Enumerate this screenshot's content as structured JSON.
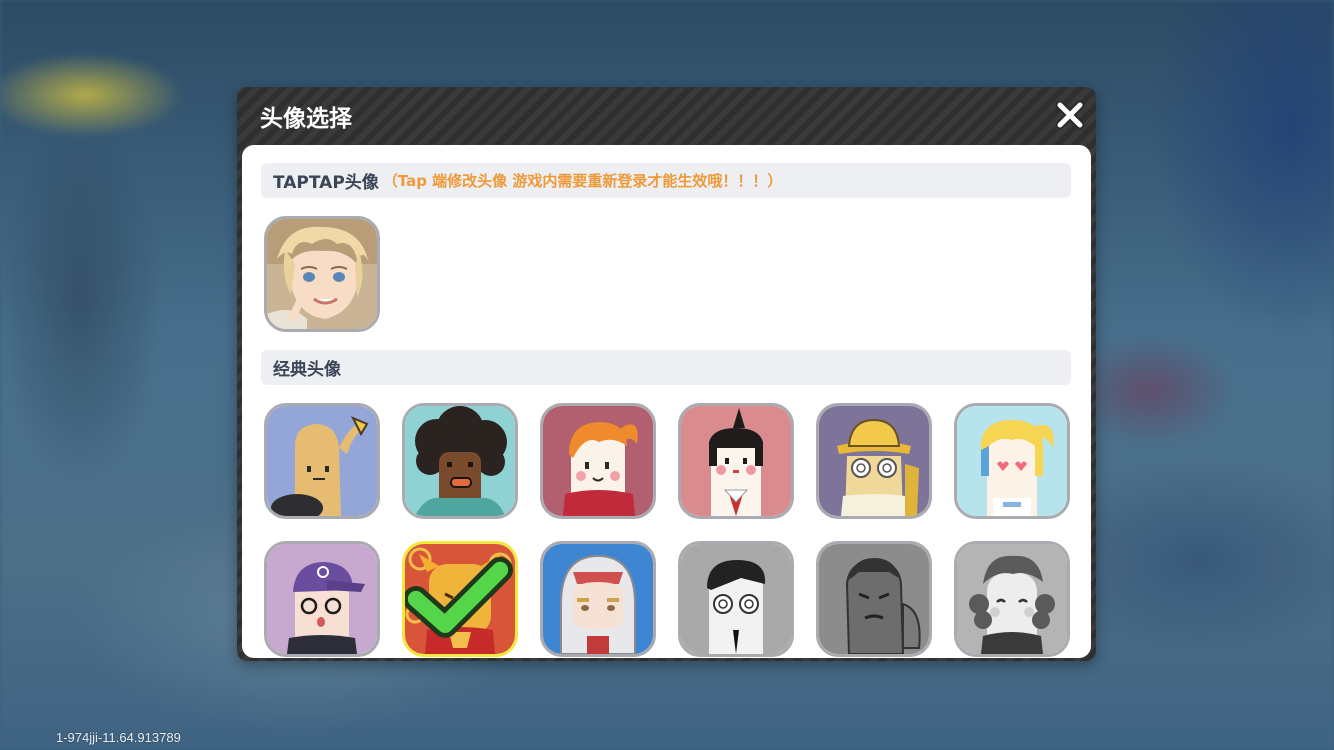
{
  "dialog": {
    "title": "头像选择",
    "close_icon": "close-icon"
  },
  "taptap_section": {
    "title": "TAPTAP头像",
    "note": "（Tap 端修改头像 游戏内需要重新登录才能生效哦！！！）"
  },
  "classic_section": {
    "title": "经典头像"
  },
  "avatars": {
    "taptap_avatar": "anime-blond-boy-avatar",
    "classic": [
      "banana-avatar",
      "afro-avatar",
      "orange-ponytail-girl-avatar",
      "black-bob-girl-avatar",
      "explorer-hat-avatar",
      "heart-eyes-girl-avatar",
      "purple-cap-boy-avatar",
      "golden-ox-avatar",
      "astronaut-avatar",
      "glasses-boy-avatar",
      "muscle-man-avatar",
      "curly-hair-lady-avatar"
    ],
    "selected": "golden-ox-avatar",
    "locked_style": "grayscale"
  },
  "colors": {
    "accent_note": "#ef9a3a",
    "section_title": "#3b4558",
    "selected_border": "#f3e93e",
    "check": "#55d64a"
  },
  "footer": {
    "version": "1-974jji-11.64.913789"
  }
}
